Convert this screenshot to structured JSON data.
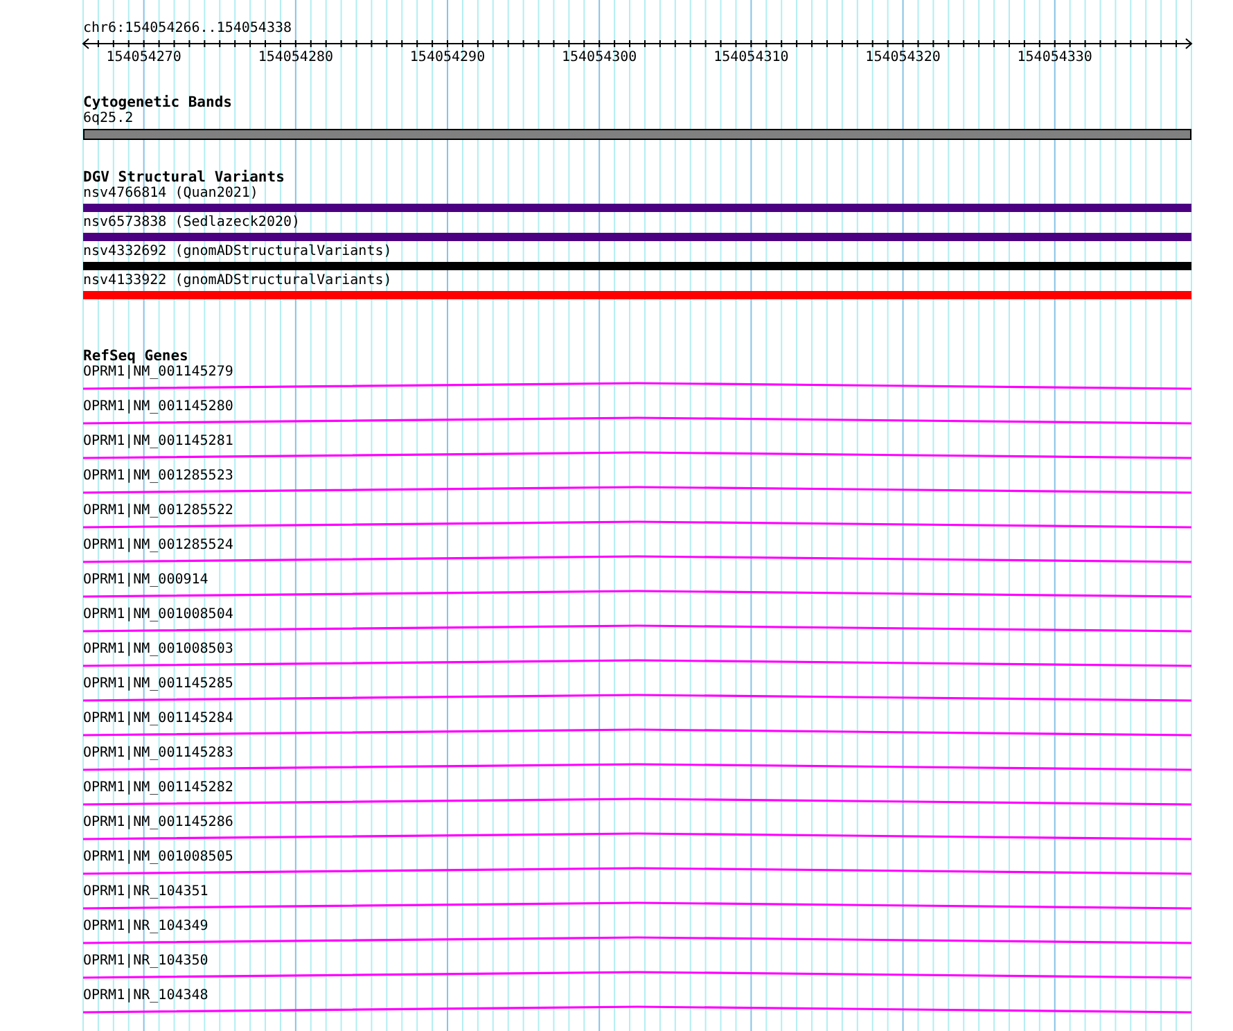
{
  "locus": "chr6:154054266..154054338",
  "ruler": {
    "labels": [
      "154054270",
      "154054280",
      "154054290",
      "154054300",
      "154054310",
      "154054320",
      "154054330"
    ]
  },
  "tracks": [
    {
      "kind": "bands",
      "title": "Cytogenetic Bands",
      "features": [
        {
          "label": "6q25.2"
        }
      ]
    },
    {
      "kind": "variants",
      "title": "DGV Structural Variants",
      "features": [
        {
          "label": "nsv4766814 (Quan2021)",
          "color": "#4b0082"
        },
        {
          "label": "nsv6573838 (Sedlazeck2020)",
          "color": "#4b0082"
        },
        {
          "label": "nsv4332692 (gnomADStructuralVariants)",
          "color": "#000000"
        },
        {
          "label": "nsv4133922 (gnomADStructuralVariants)",
          "color": "#ff0000"
        }
      ]
    },
    {
      "kind": "genes",
      "title": "RefSeq Genes",
      "features": [
        {
          "label": "OPRM1|NM_001145279"
        },
        {
          "label": "OPRM1|NM_001145280"
        },
        {
          "label": "OPRM1|NM_001145281"
        },
        {
          "label": "OPRM1|NM_001285523"
        },
        {
          "label": "OPRM1|NM_001285522"
        },
        {
          "label": "OPRM1|NM_001285524"
        },
        {
          "label": "OPRM1|NM_000914"
        },
        {
          "label": "OPRM1|NM_001008504"
        },
        {
          "label": "OPRM1|NM_001008503"
        },
        {
          "label": "OPRM1|NM_001145285"
        },
        {
          "label": "OPRM1|NM_001145284"
        },
        {
          "label": "OPRM1|NM_001145283"
        },
        {
          "label": "OPRM1|NM_001145282"
        },
        {
          "label": "OPRM1|NM_001145286"
        },
        {
          "label": "OPRM1|NM_001008505"
        },
        {
          "label": "OPRM1|NR_104351"
        },
        {
          "label": "OPRM1|NR_104349"
        },
        {
          "label": "OPRM1|NR_104350"
        },
        {
          "label": "OPRM1|NR_104348"
        }
      ]
    }
  ]
}
